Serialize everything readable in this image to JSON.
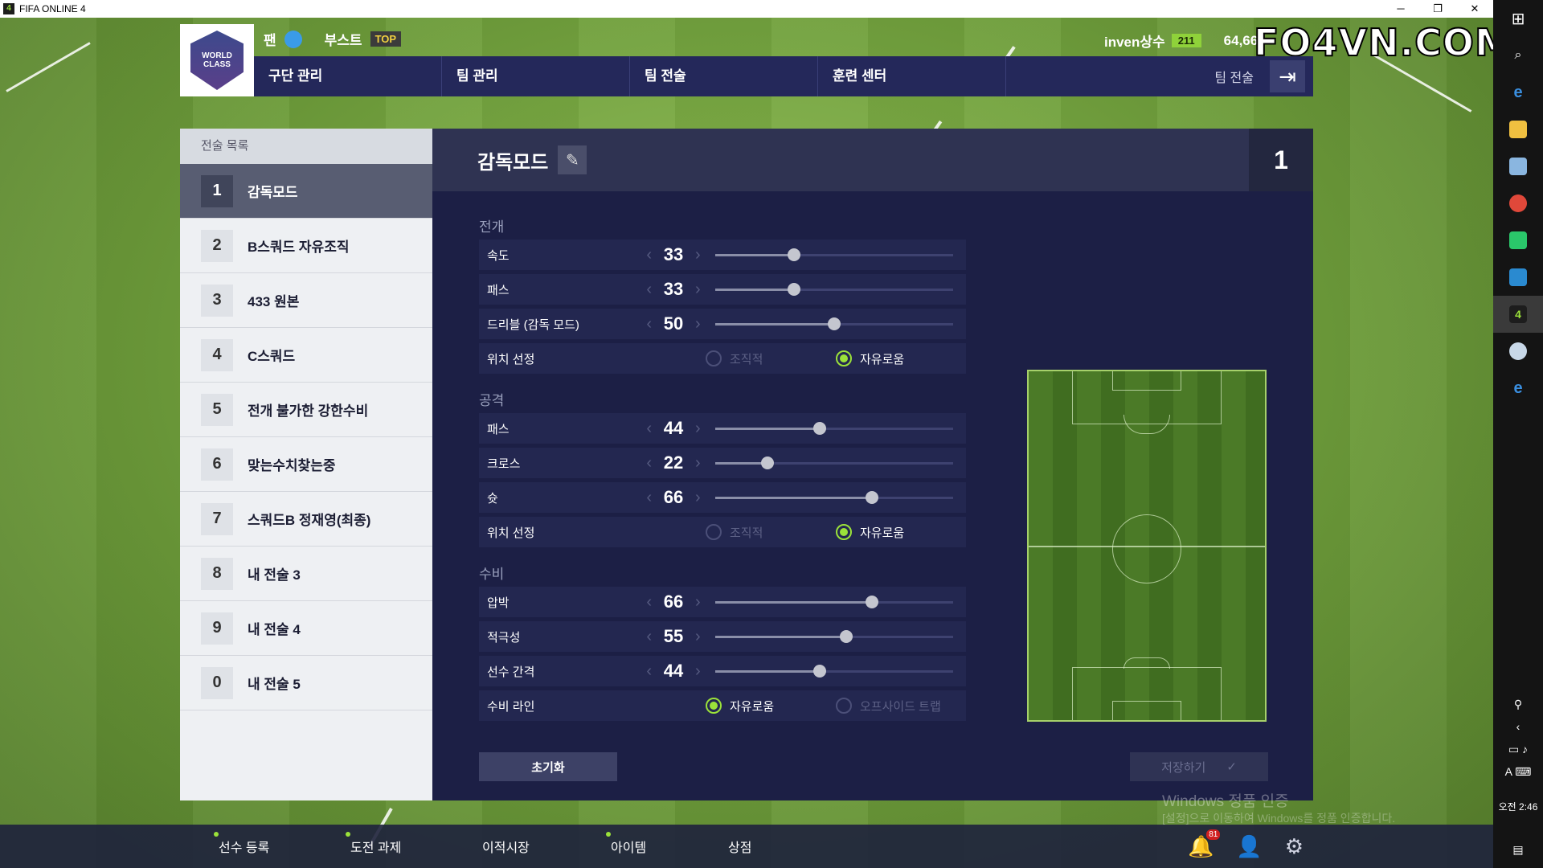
{
  "window": {
    "title": "FIFA ONLINE 4",
    "controls": [
      "─",
      "❐",
      "✕"
    ]
  },
  "header": {
    "logo_text": "WORLD CLASS",
    "fan_label": "팬",
    "boost_label": "부스트",
    "boost_badge": "TOP",
    "username": "inven상수",
    "level": "211",
    "coins": "64,66",
    "watermark": "FO4VN.COM"
  },
  "nav": {
    "items": [
      "구단 관리",
      "팀 관리",
      "팀 전술",
      "훈련 센터"
    ],
    "current": "팀 전술"
  },
  "tactics_list": {
    "title": "전술 목록",
    "items": [
      {
        "num": "1",
        "label": "감독모드"
      },
      {
        "num": "2",
        "label": "B스쿼드 자유조직"
      },
      {
        "num": "3",
        "label": "433 원본"
      },
      {
        "num": "4",
        "label": "C스쿼드"
      },
      {
        "num": "5",
        "label": "전개 불가한 강한수비"
      },
      {
        "num": "6",
        "label": "맞는수치찾는중"
      },
      {
        "num": "7",
        "label": "스쿼드B 정재영(최종)"
      },
      {
        "num": "8",
        "label": "내 전술 3"
      },
      {
        "num": "9",
        "label": "내 전술 4"
      },
      {
        "num": "0",
        "label": "내 전술 5"
      }
    ]
  },
  "main": {
    "title": "감독모드",
    "slot": "1",
    "sections": {
      "build": "전개",
      "attack": "공격",
      "defense": "수비"
    },
    "build": [
      {
        "label": "속도",
        "value": 33
      },
      {
        "label": "패스",
        "value": 33
      },
      {
        "label": "드리블 (감독 모드)",
        "value": 50
      }
    ],
    "build_position": {
      "label": "위치 선정",
      "opt1": "조직적",
      "opt2": "자유로움",
      "selected": "자유로움"
    },
    "attack": [
      {
        "label": "패스",
        "value": 44
      },
      {
        "label": "크로스",
        "value": 22
      },
      {
        "label": "슛",
        "value": 66
      }
    ],
    "attack_position": {
      "label": "위치 선정",
      "opt1": "조직적",
      "opt2": "자유로움",
      "selected": "자유로움"
    },
    "defense": [
      {
        "label": "압박",
        "value": 66
      },
      {
        "label": "적극성",
        "value": 55
      },
      {
        "label": "선수 간격",
        "value": 44
      }
    ],
    "defense_line": {
      "label": "수비 라인",
      "opt1": "자유로움",
      "opt2": "오프사이드 트랩",
      "selected": "자유로움"
    },
    "reset_label": "초기화",
    "save_label": "저장하기"
  },
  "bottom": {
    "items": [
      "선수 등록",
      "도전 과제",
      "이적시장",
      "아이템",
      "상점"
    ],
    "notif_count": "81",
    "win_activation": "Windows 정품 인증",
    "win_activation_sub": "[설정]으로 이동하여 Windows를 정품 인증합니다."
  },
  "taskbar": {
    "ime": "A",
    "ime2": "⌨",
    "clock": "오전 2:46"
  },
  "colors": {
    "accent": "#9be23a",
    "panel": "#1c1f45",
    "nav": "#24285a"
  }
}
